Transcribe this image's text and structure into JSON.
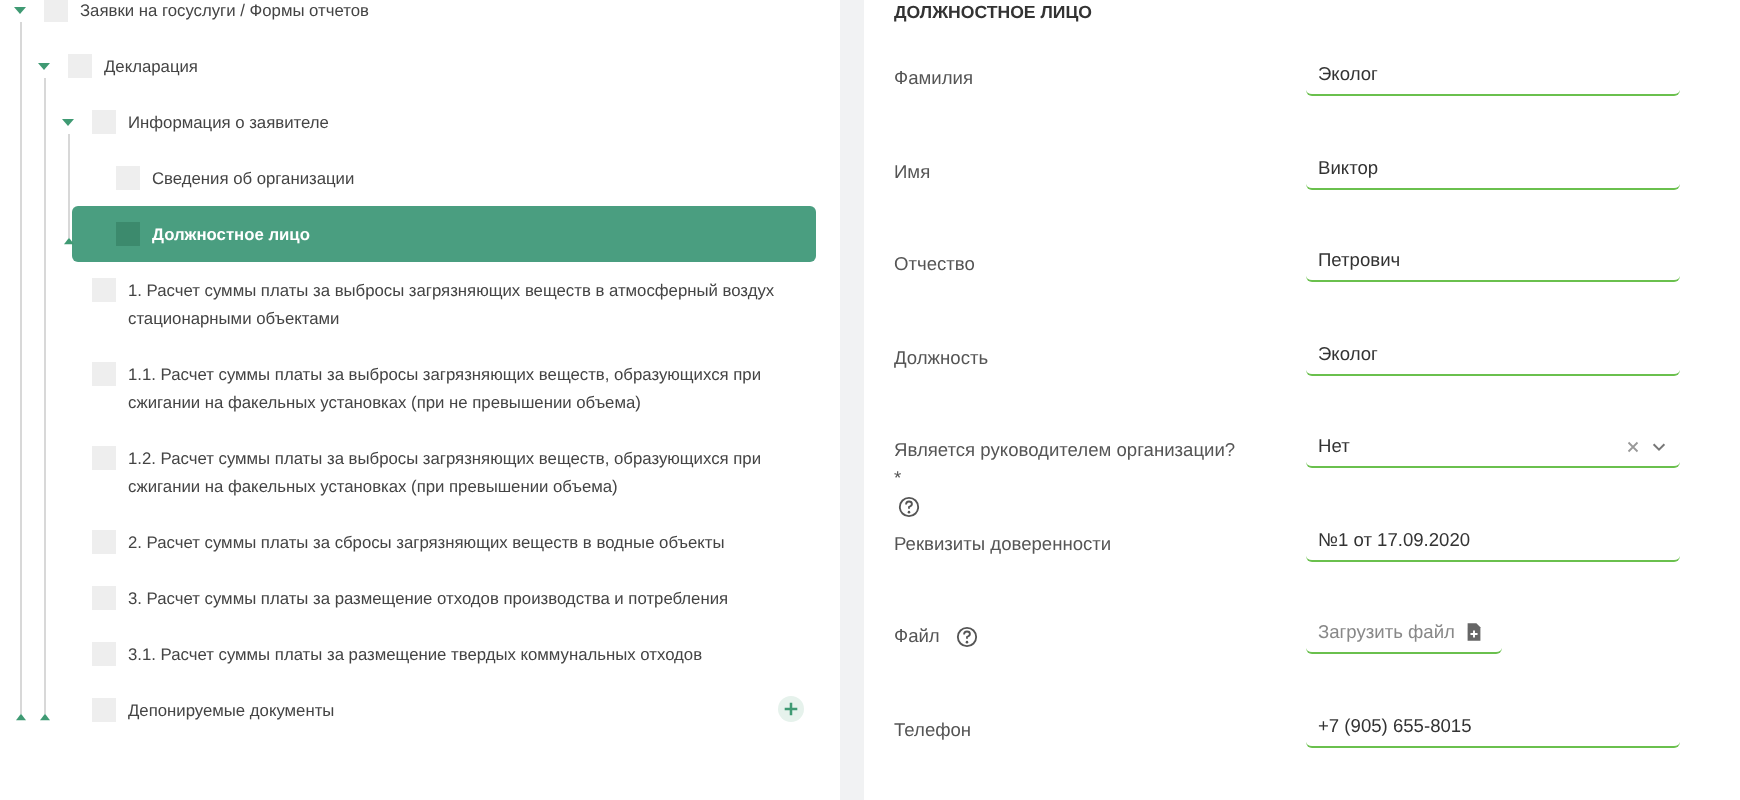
{
  "tree": [
    {
      "label": "Заявки на госуслуги / Формы отчетов",
      "checked": false,
      "selected": false,
      "can_add": false,
      "expanded": true,
      "children": [
        {
          "label": "Декларация",
          "checked": false,
          "selected": false,
          "can_add": false,
          "expanded": true,
          "children": [
            {
              "label": "Информация о заявителе",
              "checked": false,
              "selected": false,
              "can_add": false,
              "expanded": true,
              "children": [
                {
                  "label": "Сведения об организации",
                  "checked": false,
                  "selected": false,
                  "can_add": false
                },
                {
                  "label": "Должностное лицо",
                  "checked": false,
                  "selected": true,
                  "can_add": false
                }
              ]
            },
            {
              "label": "1. Расчет суммы платы за выбросы загрязняющих веществ в атмосферный воздух стационарными объектами",
              "checked": false,
              "selected": false,
              "can_add": false
            },
            {
              "label": "1.1. Расчет суммы платы за выбросы загрязняющих веществ, образующихся при сжигании на факельных установках (при не превышении объема)",
              "checked": false,
              "selected": false,
              "can_add": false
            },
            {
              "label": "1.2. Расчет суммы платы за выбросы загрязняющих веществ, образующихся при сжигании на факельных установках (при превышении объема)",
              "checked": false,
              "selected": false,
              "can_add": false
            },
            {
              "label": "2. Расчет суммы платы за сбросы загрязняющих веществ в водные объекты",
              "checked": false,
              "selected": false,
              "can_add": false
            },
            {
              "label": "3. Расчет суммы платы за размещение отходов производства и потребления",
              "checked": false,
              "selected": false,
              "can_add": false
            },
            {
              "label": "3.1. Расчет суммы платы за размещение твердых коммунальных отходов",
              "checked": false,
              "selected": false,
              "can_add": false
            },
            {
              "label": "Депонируемые документы",
              "checked": false,
              "selected": false,
              "can_add": true
            }
          ]
        }
      ]
    }
  ],
  "form": {
    "title": "ДОЛЖНОСТНОЕ ЛИЦО",
    "fields": [
      {
        "label": "Фамилия",
        "kind": "text",
        "value": "Эколог",
        "help": false
      },
      {
        "label": "Имя",
        "kind": "text",
        "value": "Виктор",
        "help": false
      },
      {
        "label": "Отчество",
        "kind": "text",
        "value": "Петрович",
        "help": false
      },
      {
        "label": "Должность",
        "kind": "text",
        "value": "Эколог",
        "help": false
      },
      {
        "label": "Является руководителем организации? *",
        "kind": "select",
        "value": "Нет",
        "help": true
      },
      {
        "label": "Реквизиты доверенности",
        "kind": "text",
        "value": "№1 от 17.09.2020",
        "help": false
      },
      {
        "label": "Файл",
        "kind": "file",
        "button": "Загрузить файл",
        "help": true
      },
      {
        "label": "Телефон",
        "kind": "text",
        "value": "+7 (905) 655-8015",
        "help": false
      }
    ]
  }
}
